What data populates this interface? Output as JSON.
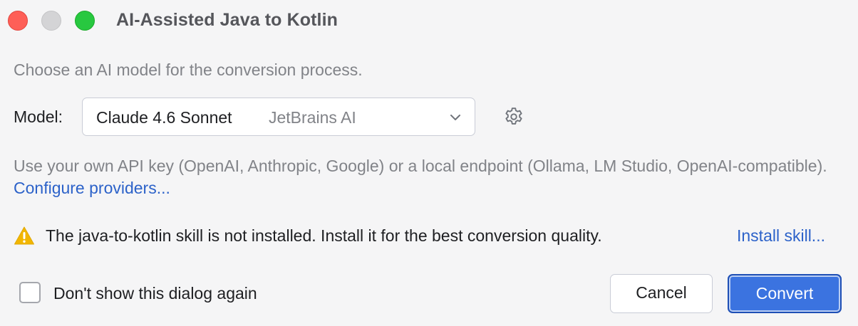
{
  "window": {
    "title": "AI-Assisted Java to Kotlin"
  },
  "dialog": {
    "description": "Choose an AI model for the conversion process.",
    "model_label": "Model:",
    "model_select": {
      "selected_model": "Claude 4.6 Sonnet",
      "selected_provider": "JetBrains AI"
    },
    "settings_icon": "gear-icon",
    "api_note_text": "Use your own API key (OpenAI, Anthropic, Google) or a local endpoint (Ollama, LM Studio, OpenAI-compatible).",
    "api_note_link": "Configure providers...",
    "warning": {
      "icon": "warning-icon",
      "text": "The java-to-kotlin skill is not installed. Install it for the best conversion quality.",
      "link": "Install skill..."
    },
    "checkbox_label": "Don't show this dialog again",
    "checkbox_checked": false,
    "cancel_label": "Cancel",
    "convert_label": "Convert"
  },
  "colors": {
    "accent": "#3b73e0",
    "link": "#2c62c9",
    "warning": "#f2b600",
    "close_light": "#fe5f57",
    "minimize_light": "#d4d4d6",
    "maximize_light": "#28c840"
  }
}
